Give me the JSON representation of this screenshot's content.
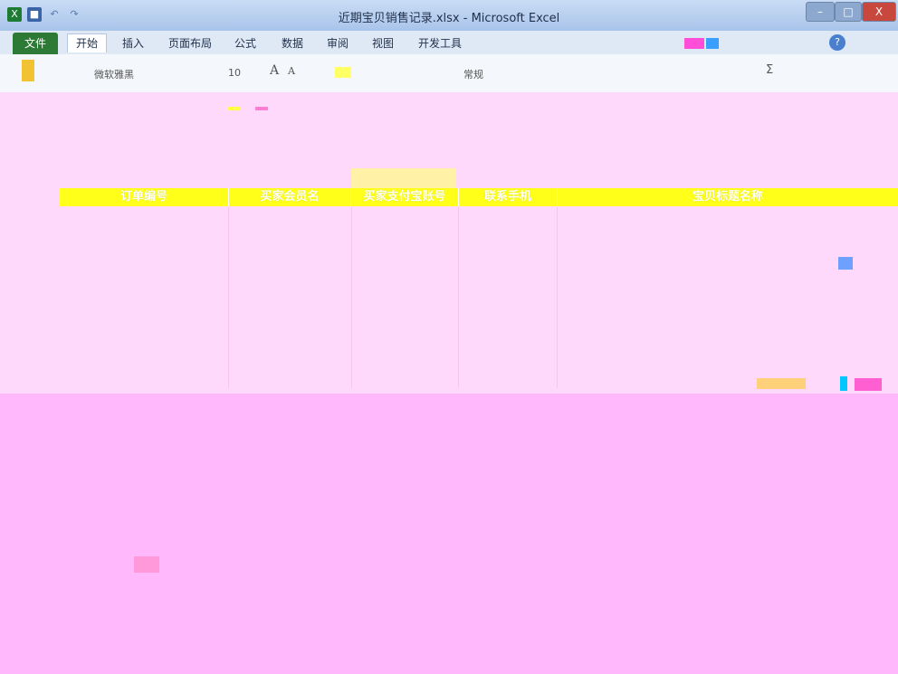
{
  "window": {
    "title": "近期宝贝销售记录.xlsx - Microsoft Excel",
    "buttons": {
      "minimize": "–",
      "maximize": "□",
      "close": "X"
    }
  },
  "ribbon_tabs": [
    "文件",
    "开始",
    "插入",
    "页面布局",
    "公式",
    "数据",
    "审阅",
    "视图",
    "开发工具"
  ],
  "ribbon": {
    "font_name": "微软雅黑",
    "font_size": "10",
    "number_format": "常规",
    "sum_symbol": "Σ"
  },
  "table": {
    "headers": [
      "订单编号",
      "买家会员名",
      "买家支付宝账号",
      "联系手机",
      "宝贝标题名称"
    ]
  },
  "colors": {
    "file_tab": "#2c7a35",
    "header_fill": "#ffff19",
    "sheet_bg": "#ffd9fb",
    "sheet_lower_bg": "#ffb8fb"
  },
  "icons": [
    "excel-logo-icon",
    "save-icon",
    "undo-icon",
    "redo-icon",
    "help-icon"
  ]
}
